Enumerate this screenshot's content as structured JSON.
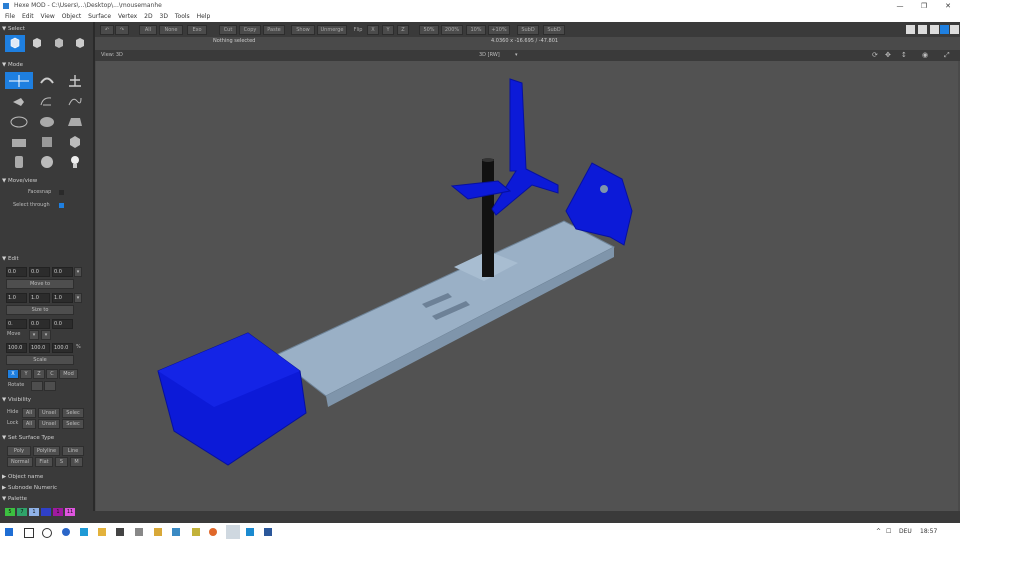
{
  "window": {
    "title": "Hexe MOD - C:\\Users\\...\\Desktop\\...\\mousemanhe"
  },
  "menu": [
    "File",
    "Edit",
    "View",
    "Object",
    "Surface",
    "Vertex",
    "2D",
    "3D",
    "Tools",
    "Help"
  ],
  "topbar": {
    "buttons": [
      "All",
      "None",
      "Exo",
      "Cut",
      "Copy",
      "Paste",
      "Show",
      "Unmerge",
      "Flip",
      "X",
      "Y",
      "Z",
      "50%",
      "200%",
      "10%",
      "+10%",
      "SubD",
      "SubD"
    ],
    "status": "Nothing selected",
    "coords": "4.0360 x -16.695 / -47.801"
  },
  "view": {
    "label": "View: 3D",
    "mode": "3D [RW]"
  },
  "panel": {
    "select_title": "Select",
    "mode_title": "Mode",
    "moveview_title": "Move/view",
    "facesnap": "Facesnap",
    "select_through": "Select through",
    "edit_title": "Edit",
    "move_values": [
      "0.0",
      "0.0",
      "0.0"
    ],
    "move_btn": "Move to",
    "size_values": [
      "1.0",
      "1.0",
      "1.0"
    ],
    "size_btn": "Size to",
    "offset_values": [
      "0.",
      "0.0",
      "0.0"
    ],
    "move_label": "Move",
    "scale_values": [
      "100.0",
      "100.0",
      "100.0"
    ],
    "pct": "%",
    "scale_btn": "Scale",
    "axes": [
      "X",
      "Y",
      "Z",
      "C",
      "Mod"
    ],
    "rotate_label": "Rotate",
    "visibility_title": "Visibility",
    "hide_row": [
      "Hide",
      "All",
      "Unsel",
      "Selec"
    ],
    "lock_row": [
      "Lock",
      "All",
      "Unsel",
      "Selec"
    ],
    "surface_title": "Set Surface Type",
    "surface_row1": [
      "Poly",
      "Polyline",
      "Line"
    ],
    "surface_row2": [
      "Normal",
      "Flat",
      "S",
      "M"
    ],
    "objname_title": "Object name",
    "subnum_title": "Subnode Numeric",
    "palette_title": "Palette",
    "palette": [
      {
        "n": "5",
        "c": "#3cc040"
      },
      {
        "n": "7",
        "c": "#2fa36a"
      },
      {
        "n": "1",
        "c": "#8fb2e8"
      },
      {
        "n": "",
        "c": "#2f40c8"
      },
      {
        "n": "1",
        "c": "#a01aa0"
      },
      {
        "n": "11",
        "c": "#e055e0"
      }
    ]
  },
  "colors": {
    "accent": "#1e7fe0",
    "part_blue": "#0c1ad8",
    "rail": "#9ab0c6"
  },
  "taskbar": {
    "tray": "DEU",
    "time": "18:57"
  }
}
